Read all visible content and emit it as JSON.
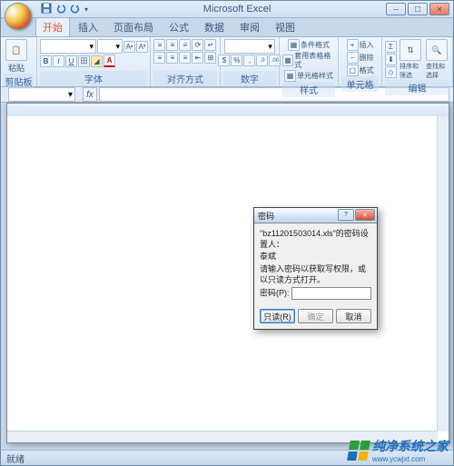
{
  "app": {
    "title": "Microsoft Excel"
  },
  "tabs": [
    "开始",
    "插入",
    "页面布局",
    "公式",
    "数据",
    "审阅",
    "视图"
  ],
  "ribbon": {
    "clipboard": {
      "label": "剪贴板",
      "paste": "粘贴"
    },
    "font": {
      "label": "字体",
      "family": "",
      "size": "",
      "bold": "B",
      "italic": "I",
      "underline": "U",
      "border": "田",
      "fill": "🪣",
      "color": "A",
      "grow": "A",
      "shrink": "A"
    },
    "align": {
      "label": "对齐方式"
    },
    "number": {
      "label": "数字",
      "pct": "%",
      "comma": ",",
      "dec_inc": ".0",
      "dec_dec": ".00"
    },
    "styles": {
      "label": "样式",
      "cond": "条件格式",
      "table": "套用表格格式",
      "cell": "单元格样式"
    },
    "cells": {
      "label": "单元格",
      "insert": "插入",
      "delete": "删除",
      "format": "格式"
    },
    "editing": {
      "label": "编辑",
      "sum": "Σ",
      "sort": "排序和筛选",
      "find": "查找和选择"
    }
  },
  "namebox_dropdown": "▾",
  "fx": "fx",
  "status": "就绪",
  "dialog": {
    "title": "密码",
    "line1": "\"bz11201503014.xls\"的密码设置人：",
    "line2": "泰斌",
    "line3": "请输入密码以获取写权限，或以只读方式打开。",
    "pw_label": "密码(P):",
    "btn_readonly": "只读(R)",
    "btn_ok": "确定",
    "btn_cancel": "取消"
  },
  "watermark": "纯净系统之家",
  "watermark_url": "www.ycwjxt.com"
}
